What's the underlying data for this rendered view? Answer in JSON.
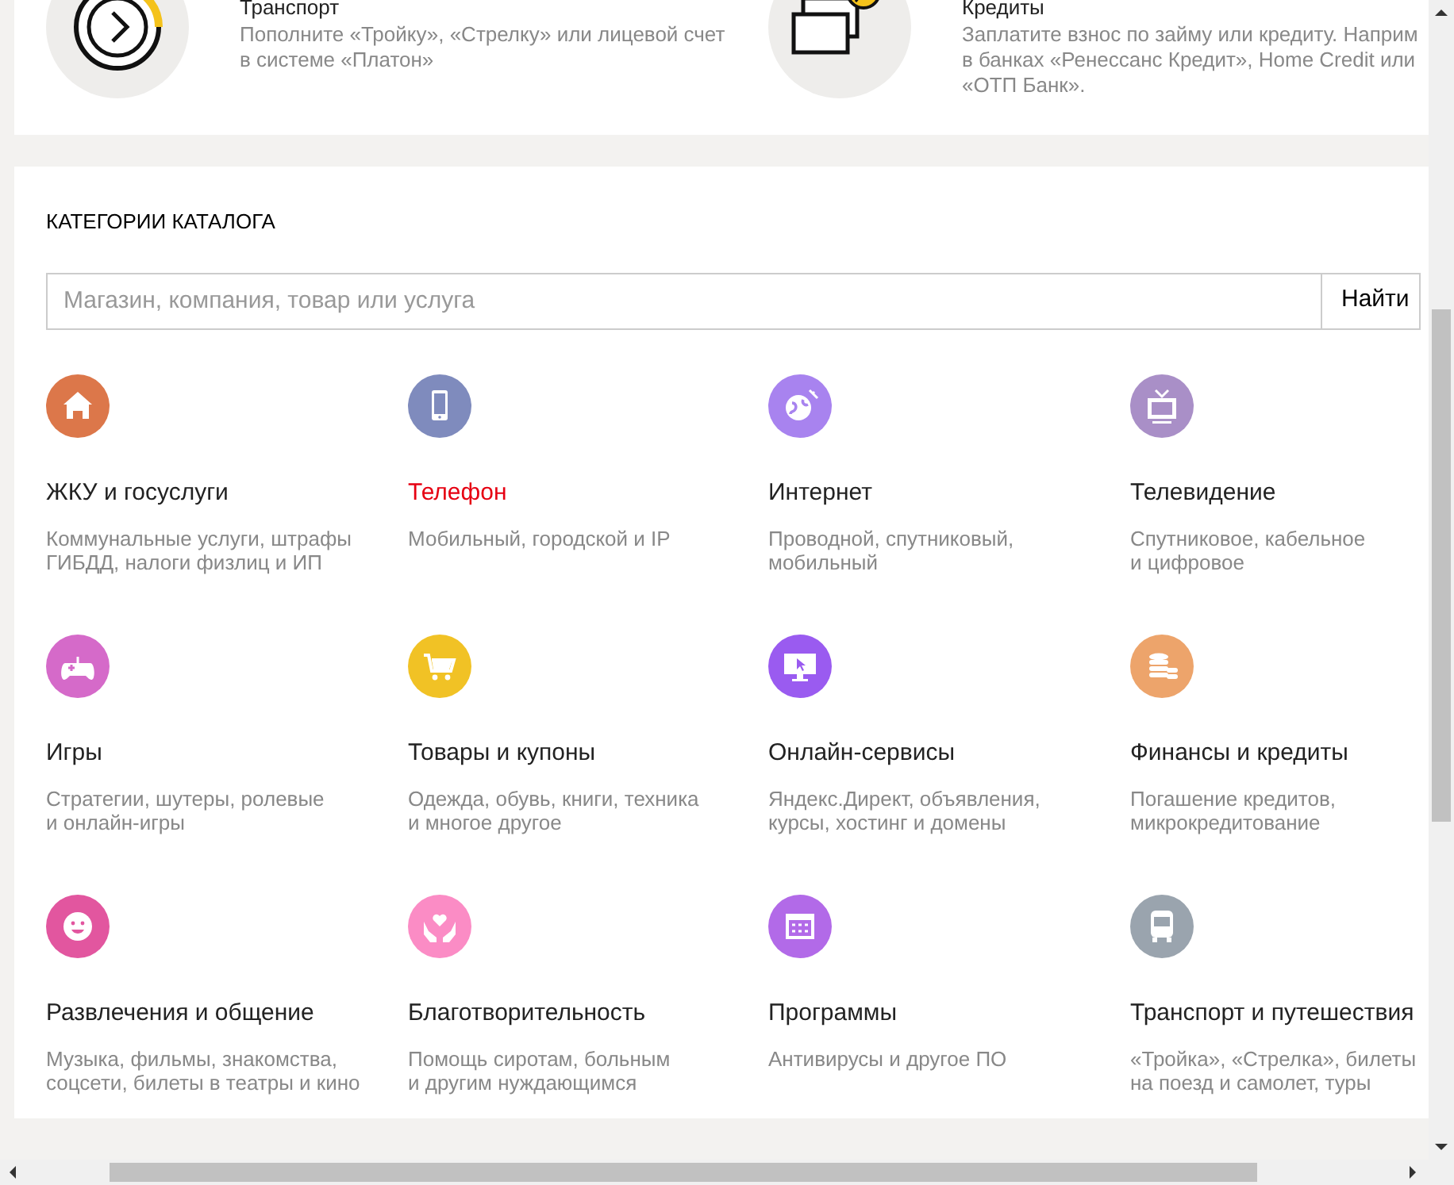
{
  "top_services": [
    {
      "title": "Транспорт",
      "description": "Пополните «Тройку», «Стрелку» или лицевой счет\nв системе «Платон»"
    },
    {
      "title": "Кредиты",
      "description": "Заплатите взнос по займу или кредиту. Наприм\nв банках «Ренессанс Кредит», Home Credit или\n«ОТП Банк»."
    }
  ],
  "catalog": {
    "heading": "КАТЕГОРИИ КАТАЛОГА",
    "search": {
      "placeholder": "Магазин, компания, товар или услуга",
      "button": "Найти"
    },
    "categories": [
      {
        "title": "ЖКУ и госуслуги",
        "description": "Коммунальные услуги, штрафы\nГИБДД, налоги физлиц и ИП",
        "color": "#dc774a",
        "hovered": false
      },
      {
        "title": "Телефон",
        "description": "Мобильный, городской и IP",
        "color": "#7f8bbd",
        "hovered": true
      },
      {
        "title": "Интернет",
        "description": "Проводной, спутниковый,\nмобильный",
        "color": "#a883ef",
        "hovered": false
      },
      {
        "title": "Телевидение",
        "description": "Спутниковое, кабельное\nи цифровое",
        "color": "#a98fc7",
        "hovered": false
      },
      {
        "title": "Игры",
        "description": "Стратегии, шутеры, ролевые\nи онлайн-игры",
        "color": "#d56ac9",
        "hovered": false
      },
      {
        "title": "Товары и купоны",
        "description": "Одежда, обувь, книги, техника\nи многое другое",
        "color": "#f1c225",
        "hovered": false
      },
      {
        "title": "Онлайн-сервисы",
        "description": "Яндекс.Директ, объявления,\nкурсы, хостинг и домены",
        "color": "#9a5bf0",
        "hovered": false
      },
      {
        "title": "Финансы и кредиты",
        "description": "Погашение кредитов,\nмикрокредитование",
        "color": "#eda46b",
        "hovered": false
      },
      {
        "title": "Развлечения и общение",
        "description": "Музыка, фильмы, знакомства,\nсоцсети, билеты в театры и кино",
        "color": "#e2569f",
        "hovered": false
      },
      {
        "title": "Благотворительность",
        "description": "Помощь сиротам, больным\nи другим нуждающимся",
        "color": "#fb8cc5",
        "hovered": false
      },
      {
        "title": "Программы",
        "description": "Антивирусы и другое ПО",
        "color": "#b26ae8",
        "hovered": false
      },
      {
        "title": "Транспорт и путешествия",
        "description": "«Тройка», «Стрелка», билеты\nна поезд и самолет, туры",
        "color": "#9aa4ae",
        "hovered": false
      }
    ]
  }
}
